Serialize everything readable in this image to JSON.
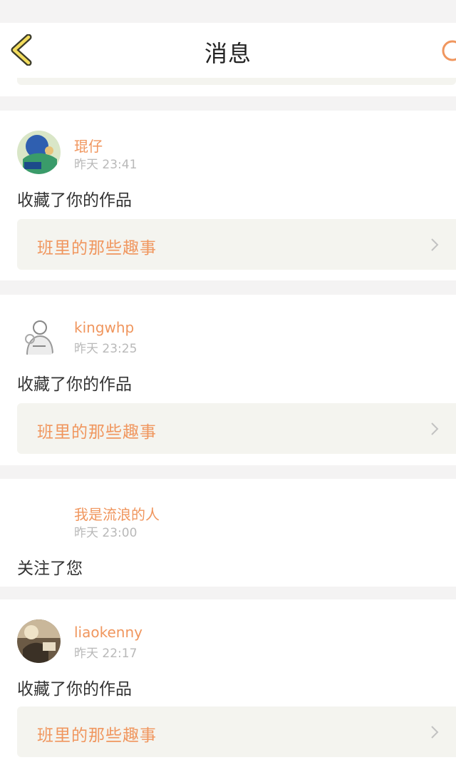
{
  "header": {
    "title": "消息",
    "back_icon": "chevron-left-icon",
    "right_icon": "refresh-icon",
    "accent_color": "#f0965e"
  },
  "messages": [
    {
      "username": "琨仔",
      "time": "昨天 23:41",
      "action": "收藏了你的作品",
      "work_title": "班里的那些趣事"
    },
    {
      "username": "kingwhp",
      "time": "昨天 23:25",
      "action": "收藏了你的作品",
      "work_title": "班里的那些趣事"
    },
    {
      "username": "我是流浪的人",
      "time": "昨天 23:00",
      "action": "关注了您"
    },
    {
      "username": "liaokenny",
      "time": "昨天 22:17",
      "action": "收藏了你的作品",
      "work_title": "班里的那些趣事"
    }
  ]
}
